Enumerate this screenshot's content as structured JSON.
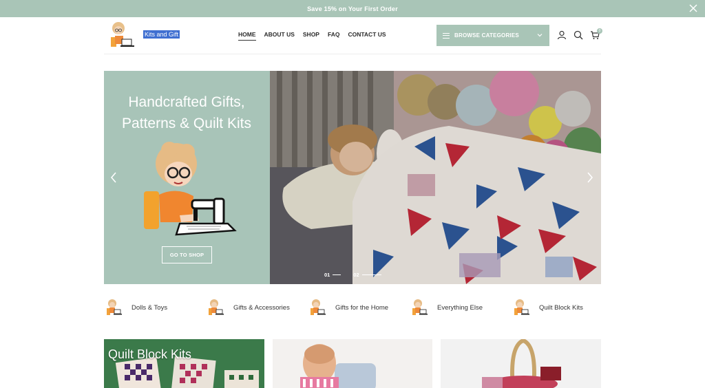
{
  "promo": {
    "text": "Save 15% on Your First Order",
    "close_icon": "close-icon"
  },
  "header": {
    "site_title": "Kits and Gift",
    "nav": [
      {
        "label": "HOME",
        "active": true
      },
      {
        "label": "ABOUT US",
        "active": false
      },
      {
        "label": "SHOP",
        "active": false
      },
      {
        "label": "FAQ",
        "active": false
      },
      {
        "label": "CONTACT US",
        "active": false
      }
    ],
    "browse_label": "BROWSE CATEGORIES",
    "cart_count": "0",
    "icons": [
      "account-icon",
      "search-icon",
      "cart-icon"
    ]
  },
  "hero": {
    "title_line1": "Handcrafted Gifts,",
    "title_line2": "Patterns & Quilt Kits",
    "button_label": "GO TO SHOP",
    "slides": [
      {
        "label": "01"
      },
      {
        "label": "02"
      }
    ]
  },
  "categories": [
    {
      "label": "Dolls & Toys"
    },
    {
      "label": "Gifts & Accessories"
    },
    {
      "label": "Gifts for the Home"
    },
    {
      "label": "Everything Else"
    },
    {
      "label": "Quilt Block Kits"
    }
  ],
  "tiles": [
    {
      "title": "Quilt Block Kits"
    }
  ],
  "colors": {
    "accent": "#a9c5b7",
    "text": "#333333"
  }
}
